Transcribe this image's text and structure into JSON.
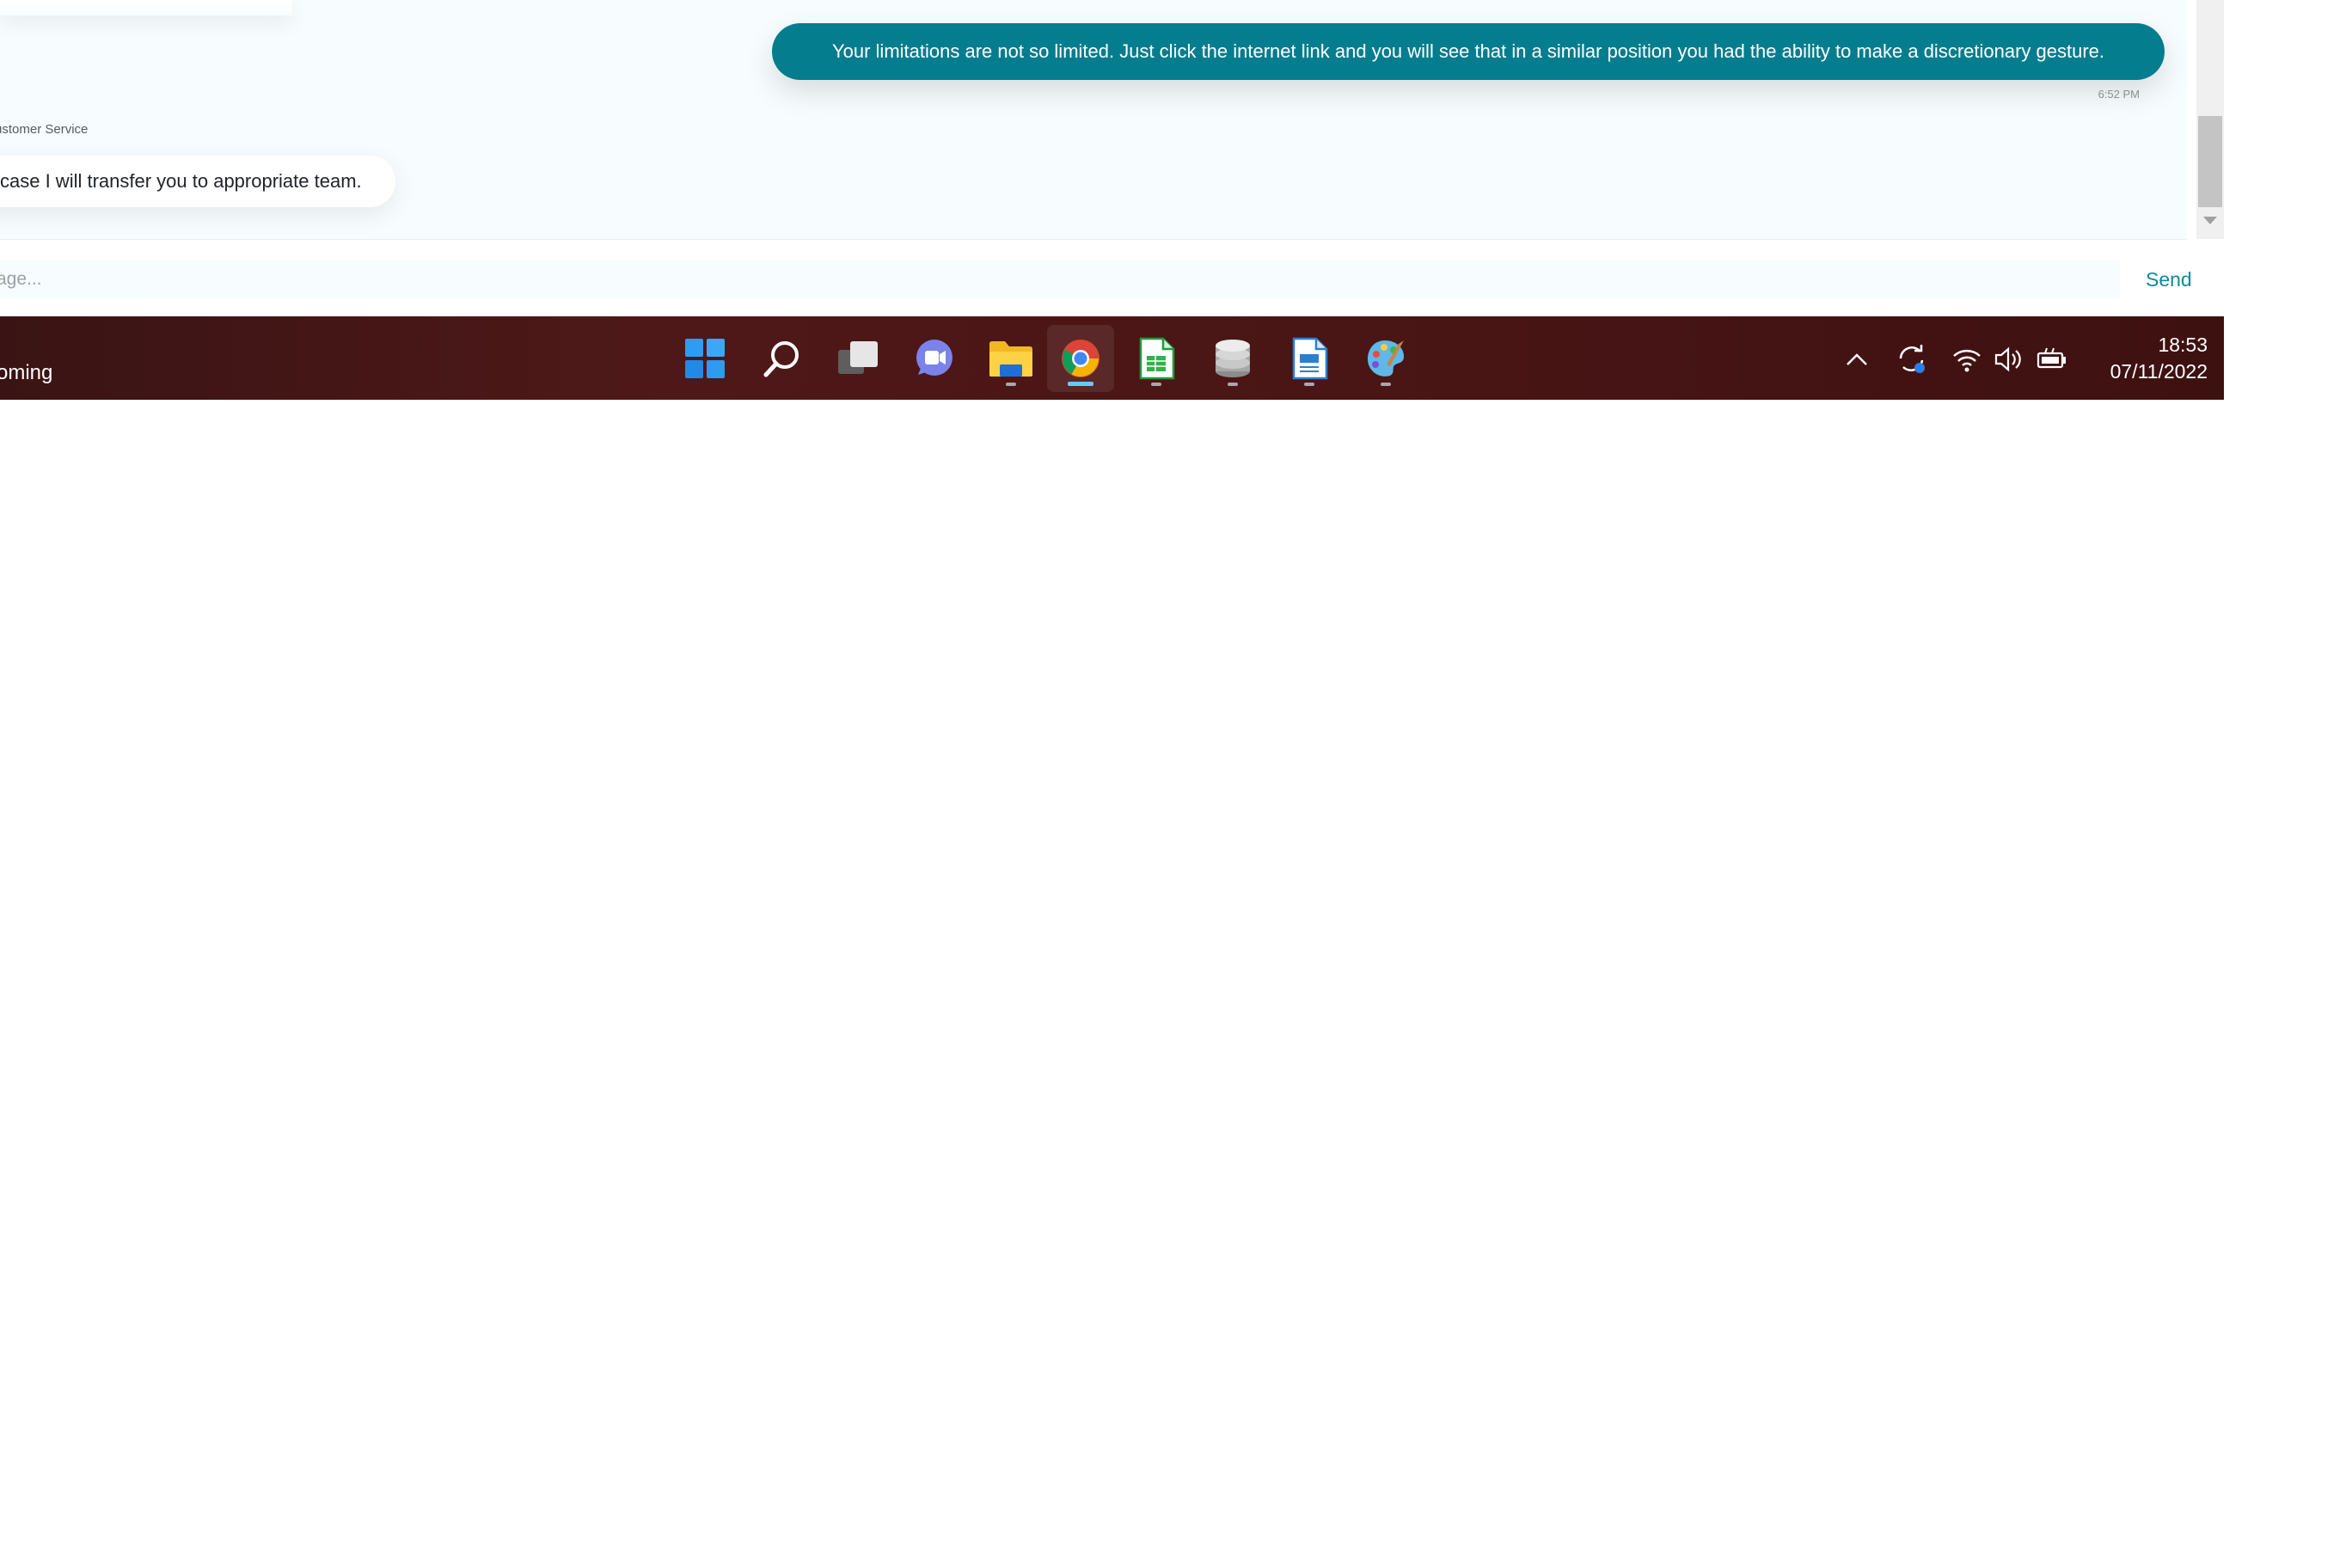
{
  "chat": {
    "user_message": "Your limitations are not so limited. Just click the internet link and you will see that in a similar position you had the ability to make a discretionary gesture.",
    "user_message_time": "6:52 PM",
    "agent_label": "ustomer Service",
    "agent_message": "case I will transfer you to appropriate team."
  },
  "composer": {
    "placeholder": "age...",
    "send_label": "Send",
    "accent_color": "#047d8f"
  },
  "taskbar": {
    "weather_text": "oming",
    "apps": [
      {
        "name": "start-icon",
        "active": false,
        "running": false
      },
      {
        "name": "search-icon",
        "active": false,
        "running": false
      },
      {
        "name": "task-view-icon",
        "active": false,
        "running": false
      },
      {
        "name": "chat-icon",
        "active": false,
        "running": false
      },
      {
        "name": "file-explorer-icon",
        "active": false,
        "running": true
      },
      {
        "name": "chrome-icon",
        "active": true,
        "running": true
      },
      {
        "name": "spreadsheet-icon",
        "active": false,
        "running": true
      },
      {
        "name": "database-icon",
        "active": false,
        "running": true
      },
      {
        "name": "document-icon",
        "active": false,
        "running": true
      },
      {
        "name": "paint-icon",
        "active": false,
        "running": true
      }
    ],
    "tray": [
      "chevron-up-icon",
      "sync-icon",
      "wifi-icon",
      "volume-icon",
      "battery-icon"
    ],
    "time": "18:53",
    "date": "07/11/2022",
    "background_color": "#4a1515"
  }
}
